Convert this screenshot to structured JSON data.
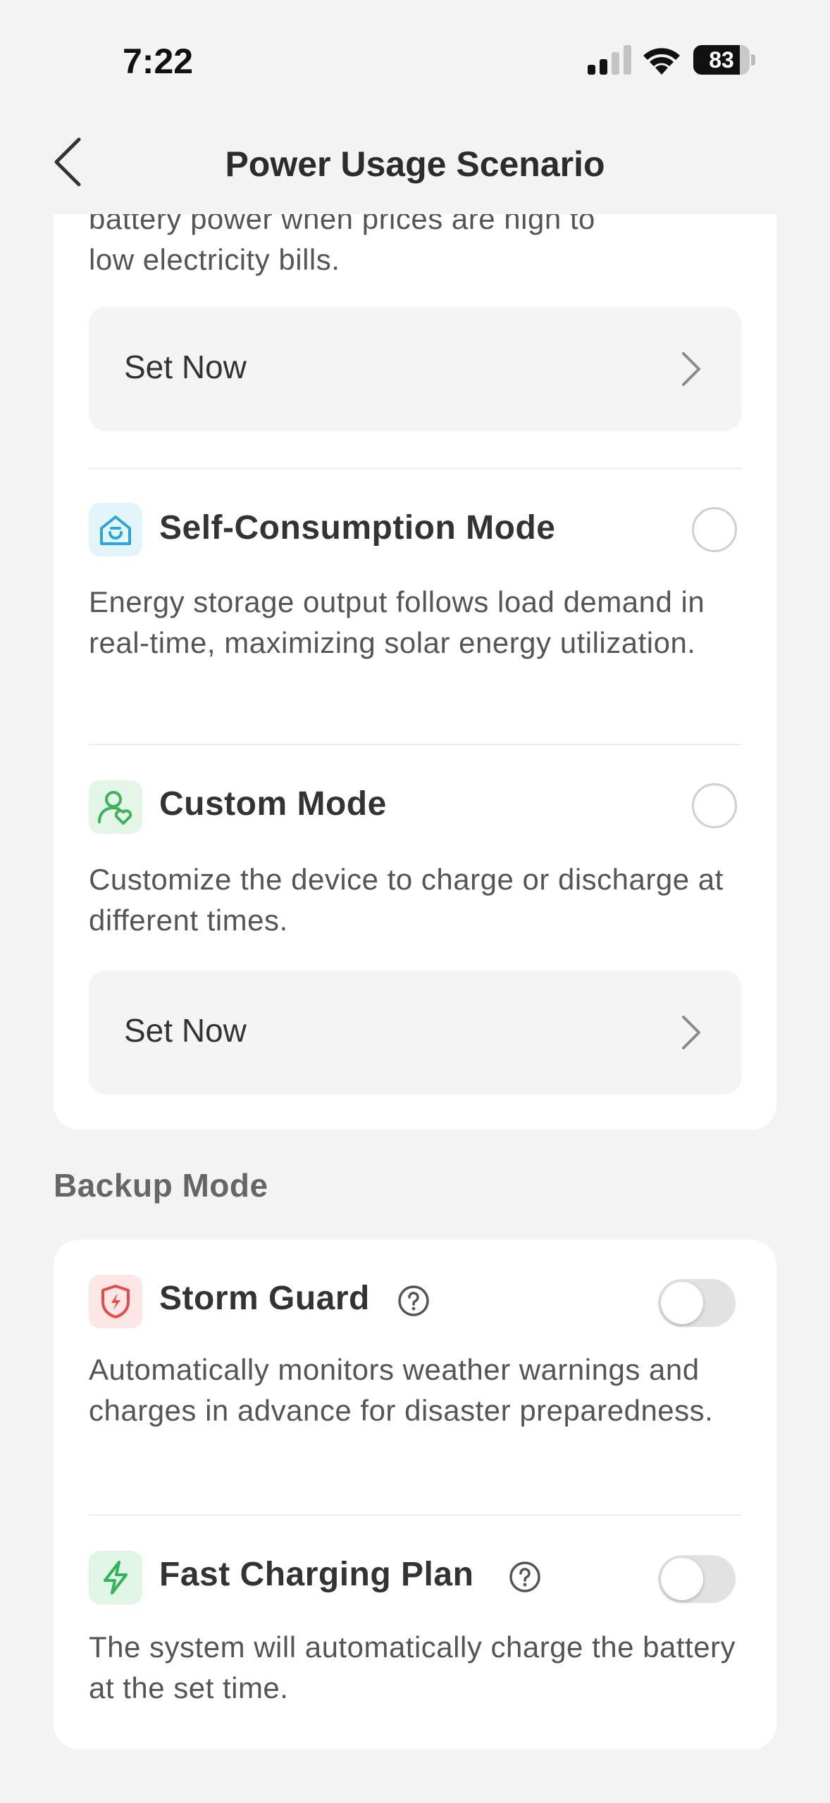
{
  "status_bar": {
    "time": "7:22",
    "battery_level": "83",
    "battery_fraction": 0.83,
    "icons": [
      "signal-icon",
      "wifi-icon",
      "battery-icon"
    ]
  },
  "nav": {
    "title": "Power Usage Scenario",
    "back_icon": "chevron-left-icon"
  },
  "scenario_card": {
    "partial_desc_line1": "battery power when prices are high to",
    "partial_desc_line2": "low electricity bills.",
    "set_now_1": "Set Now",
    "self_consumption": {
      "title": "Self-Consumption Mode",
      "description": "Energy storage output follows load demand in real-time, maximizing solar energy utilization.",
      "icon": "home-icon",
      "icon_bg": "#e3f4fb",
      "icon_color": "#2aa7d9"
    },
    "custom": {
      "title": "Custom Mode",
      "description": "Customize the device to charge or discharge at different times.",
      "icon": "user-heart-icon",
      "icon_bg": "#e3f6e8",
      "icon_color": "#3cb35b"
    },
    "set_now_2": "Set Now"
  },
  "backup_section": {
    "heading": "Backup Mode",
    "storm_guard": {
      "title": "Storm Guard",
      "description": "Automatically monitors weather warnings and charges in advance for disaster preparedness.",
      "icon": "shield-bolt-icon",
      "icon_bg": "#fde6e6",
      "icon_color": "#e54b4b",
      "enabled": false
    },
    "fast_charging": {
      "title": "Fast Charging Plan",
      "description": "The system will automatically charge the battery at the set time.",
      "icon": "bolt-icon",
      "icon_bg": "#e1f6e7",
      "icon_color": "#30b455",
      "enabled": false
    }
  }
}
